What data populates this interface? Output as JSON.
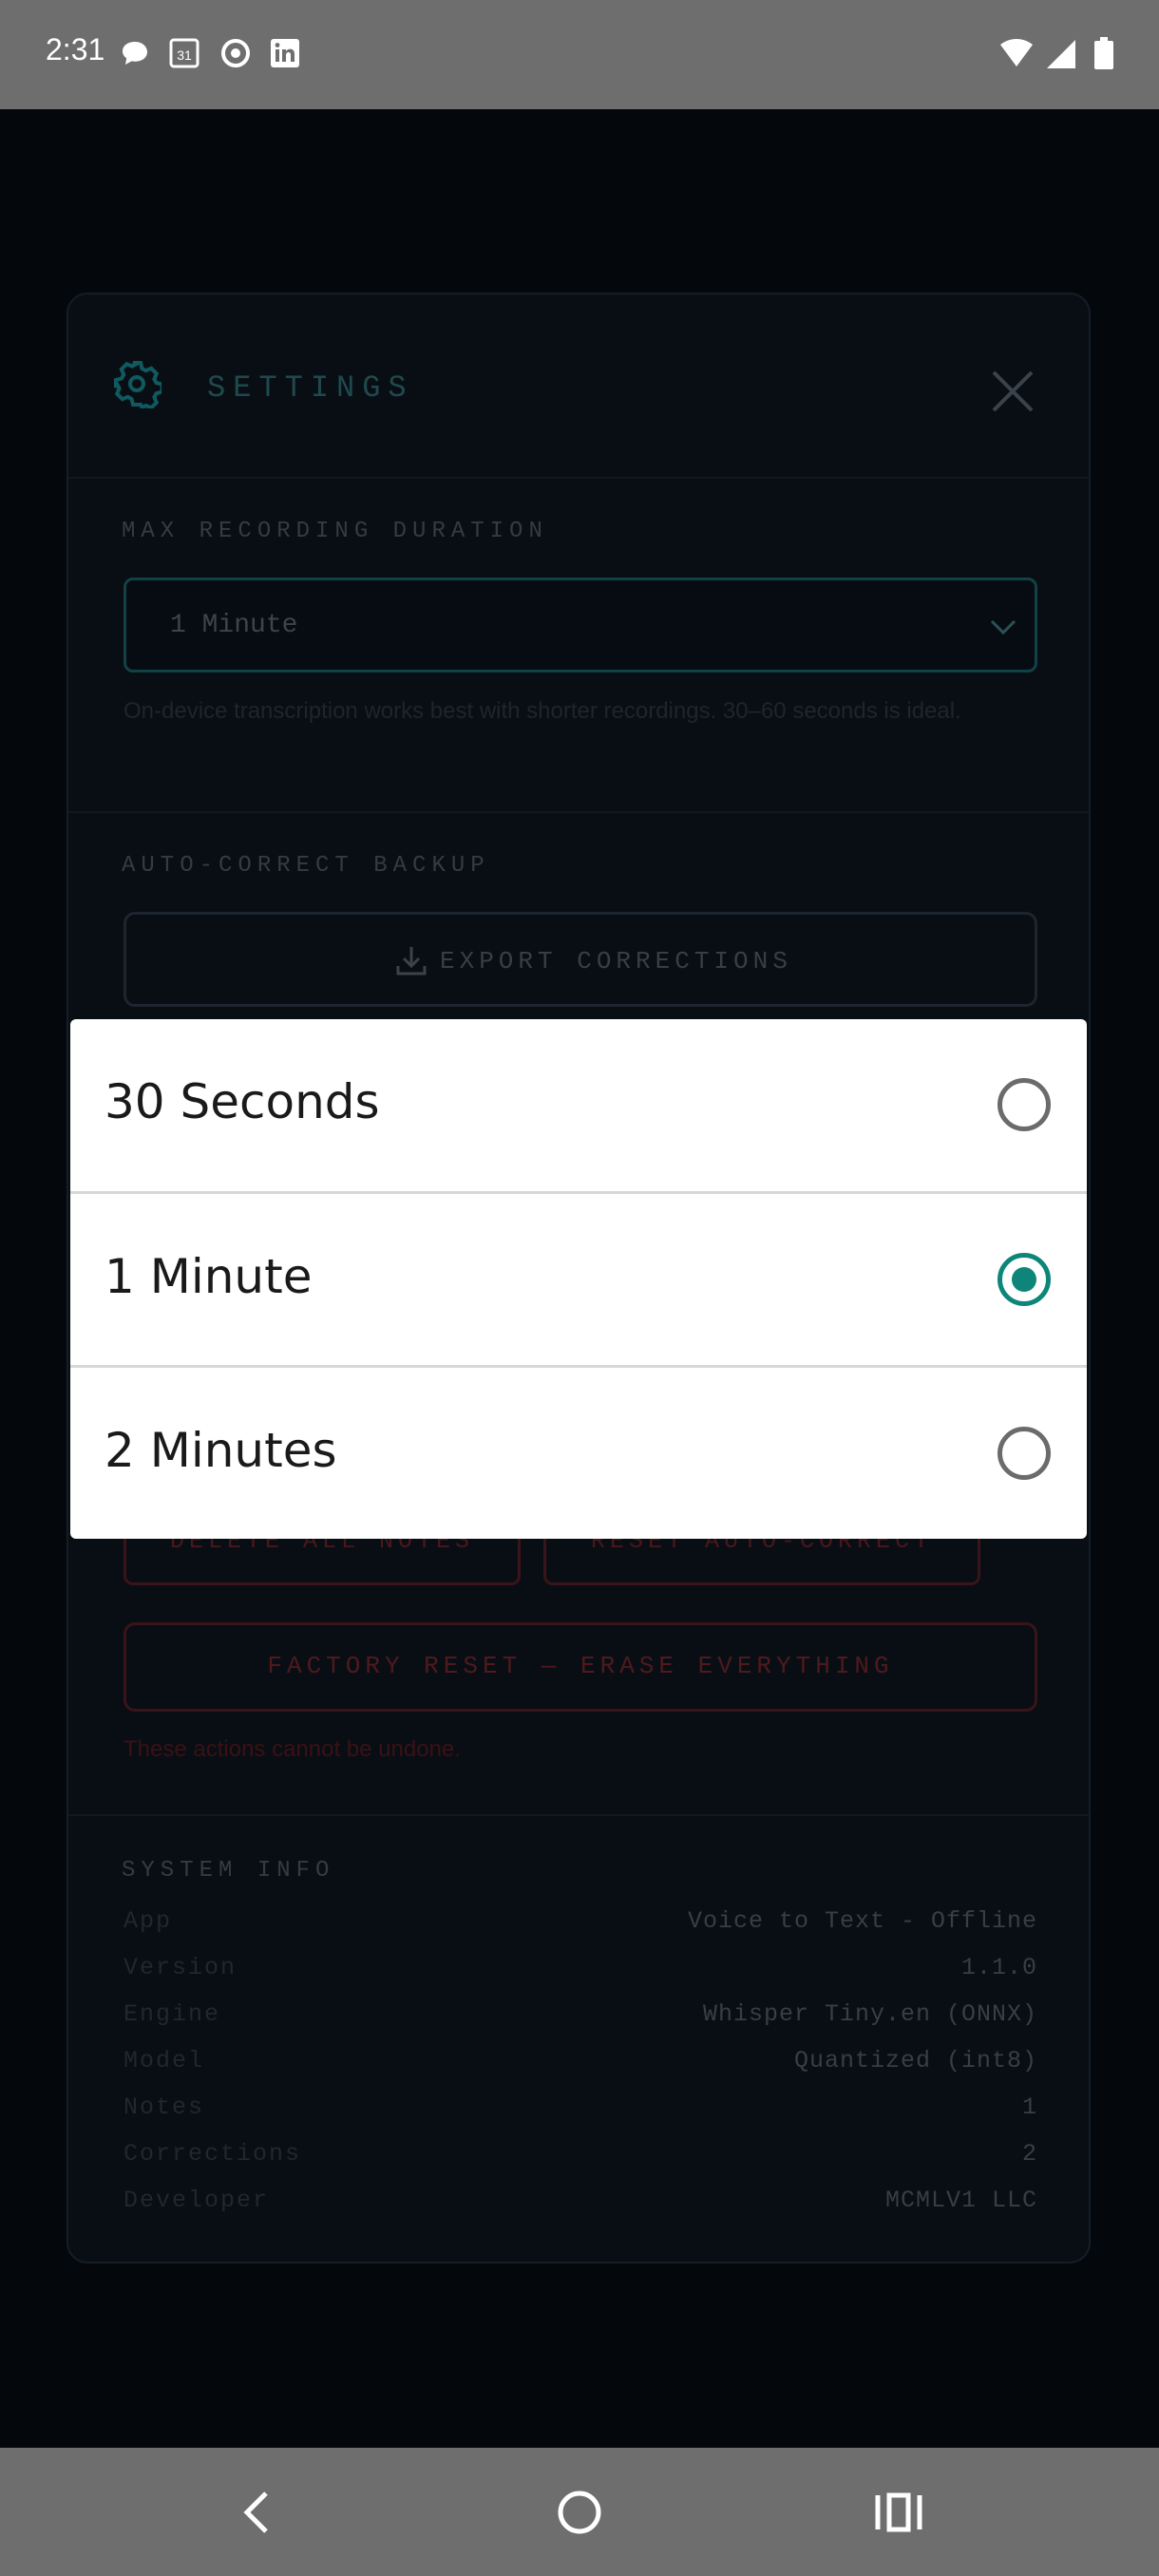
{
  "status_bar": {
    "time": "2:31",
    "left_icons": [
      "chat-bubble-icon",
      "calendar-31-icon",
      "record-icon",
      "linkedin-icon"
    ],
    "calendar_day": "31",
    "right_icons": [
      "wifi-icon",
      "signal-icon",
      "battery-icon"
    ]
  },
  "settings": {
    "title": "SETTINGS",
    "max_recording": {
      "label": "MAX RECORDING DURATION",
      "selected": "1 Minute",
      "hint": "On-device transcription works best with shorter recordings. 30–60 seconds is ideal."
    },
    "autocorrect_backup": {
      "label": "AUTO-CORRECT BACKUP",
      "export_label": "EXPORT CORRECTIONS"
    },
    "danger": {
      "delete_notes": "DELETE ALL NOTES",
      "reset_autocorrect": "RESET AUTO-CORRECT",
      "factory_reset": "FACTORY RESET — ERASE EVERYTHING",
      "warning": "These actions cannot be undone."
    },
    "system_info": {
      "label": "SYSTEM INFO",
      "rows": [
        {
          "key": "App",
          "value": "Voice to Text - Offline"
        },
        {
          "key": "Version",
          "value": "1.1.0"
        },
        {
          "key": "Engine",
          "value": "Whisper Tiny.en (ONNX)"
        },
        {
          "key": "Model",
          "value": "Quantized (int8)"
        },
        {
          "key": "Notes",
          "value": "1"
        },
        {
          "key": "Corrections",
          "value": "2"
        },
        {
          "key": "Developer",
          "value": "MCMLV1 LLC"
        }
      ]
    }
  },
  "picker": {
    "options": [
      {
        "label": "30 Seconds",
        "selected": false
      },
      {
        "label": "1 Minute",
        "selected": true
      },
      {
        "label": "2 Minutes",
        "selected": false
      }
    ],
    "accent": "#0d8578"
  },
  "nav_bar": {
    "icons": [
      "back-icon",
      "home-icon",
      "recents-icon"
    ]
  }
}
